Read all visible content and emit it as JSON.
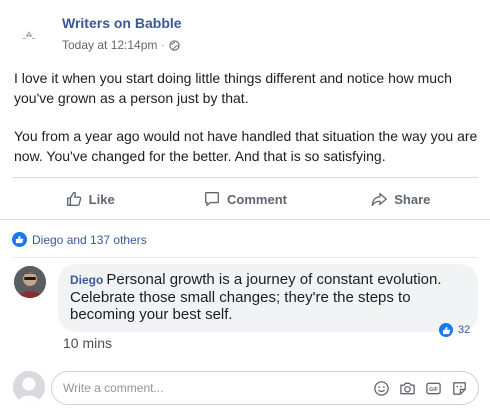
{
  "post": {
    "page_name": "Writers on Babble",
    "page_logo_text": "_⁂_",
    "timestamp": "Today at 12:14pm",
    "separator": "·",
    "paragraphs": [
      "I love it when you start doing little things different and notice how much you've grown as a person just by that.",
      "You from a year ago would not have handled that situation the way you are now. You've changed for the better. And that is so satisfying."
    ]
  },
  "actions": {
    "like": "Like",
    "comment": "Comment",
    "share": "Share"
  },
  "reactions": {
    "summary": "Diego and 137 others"
  },
  "comment": {
    "author": "Diego",
    "text": "Personal growth is a journey of constant evolution. Celebrate those small changes; they're the steps to becoming your best self.",
    "likes": "32",
    "time": "10 mins"
  },
  "composer": {
    "placeholder": "Write a comment..."
  },
  "colors": {
    "brand": "#385898",
    "like_blue": "#1877f2",
    "muted": "#606770"
  }
}
